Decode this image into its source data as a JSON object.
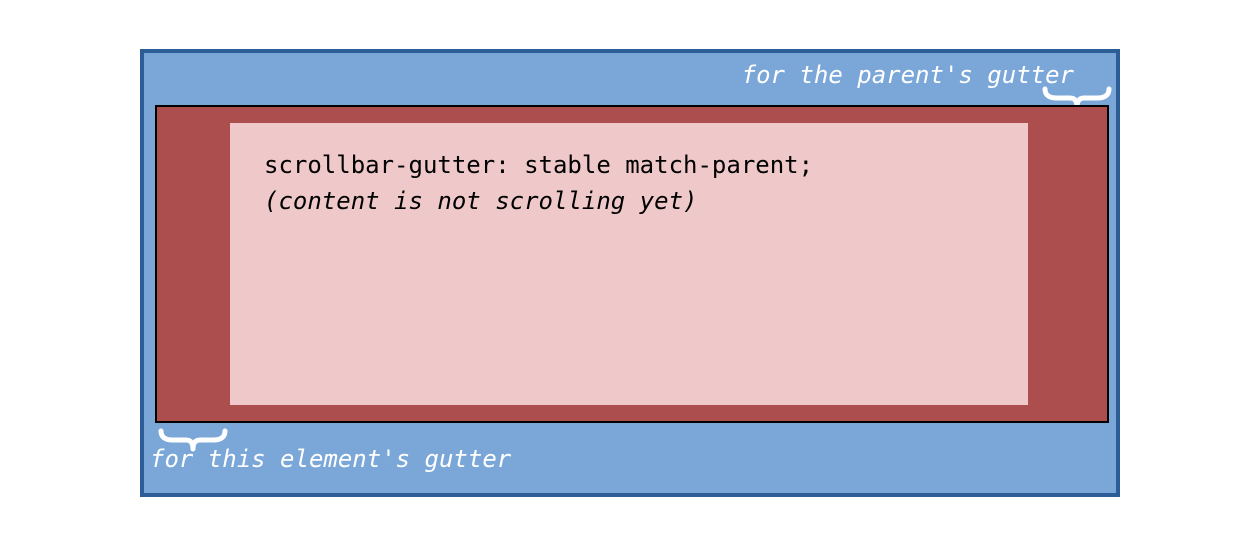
{
  "colors": {
    "parent_fill": "#7aa7d7",
    "parent_border": "#2d5d97",
    "child_fill": "#ad4e4e",
    "child_border": "#000000",
    "content_fill": "#efc9c9",
    "brace_stroke": "#ffffff",
    "label_color": "#ffffff",
    "text_color": "#000000"
  },
  "labels": {
    "parent_gutter": "for the parent's gutter",
    "element_gutter": "for this element's gutter"
  },
  "content": {
    "code": "scrollbar-gutter: stable match-parent;",
    "note": "(content is not scrolling yet)"
  }
}
